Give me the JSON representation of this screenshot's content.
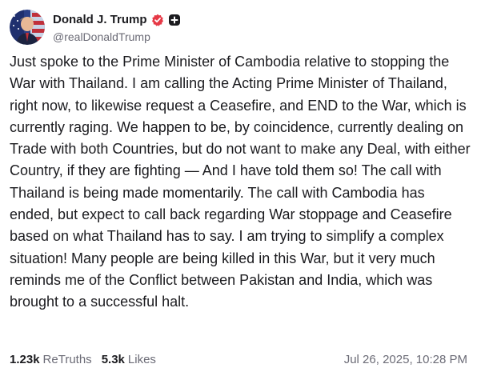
{
  "author": {
    "display_name": "Donald J. Trump",
    "handle": "@realDonaldTrump",
    "verified_icon": "verified-badge-icon",
    "follow_icon": "plus-square-icon",
    "accent_color": "#e63946"
  },
  "post": {
    "text": "Just spoke to the Prime Minister of Cambodia relative to stopping the War with Thailand. I am calling the Acting Prime Minister of Thailand, right now, to likewise request a Ceasefire, and END to the War, which is currently raging. We happen to be, by coincidence, currently dealing on Trade with both Countries, but do not want to make any Deal, with either Country, if they are fighting — And I have told them so! The call with Thailand is being made momentarily. The call with Cambodia has ended, but expect to call back regarding War stoppage and Ceasefire based on what Thailand has to say. I am trying to simplify a complex situation! Many people are being killed in this War, but it very much reminds me of the Conflict between Pakistan and India, which was brought to a successful halt."
  },
  "footer": {
    "retruths_count": "1.23k",
    "retruths_label": "ReTruths",
    "likes_count": "5.3k",
    "likes_label": "Likes",
    "timestamp": "Jul 26, 2025, 10:28 PM"
  }
}
